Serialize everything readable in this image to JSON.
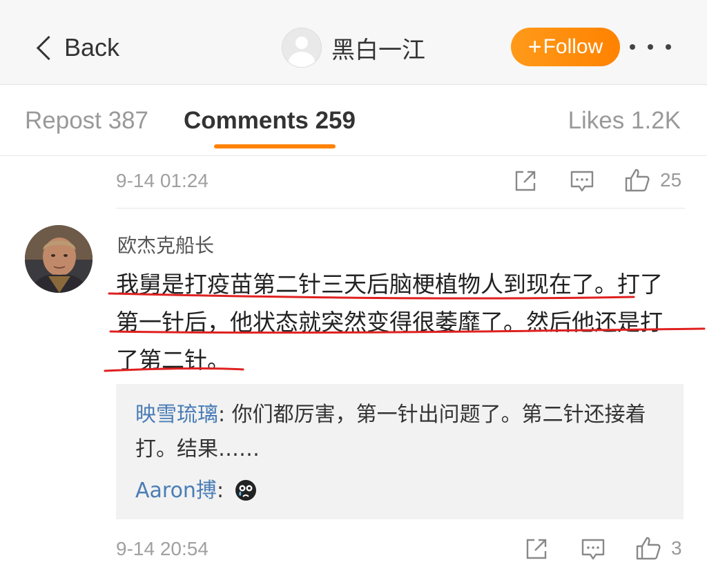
{
  "header": {
    "back_label": "Back",
    "profile_name": "黑白一江",
    "follow_label": "Follow",
    "follow_prefix": "+"
  },
  "tabs": {
    "repost": "Repost 387",
    "comments": "Comments 259",
    "likes": "Likes 1.2K"
  },
  "colors": {
    "accent": "#ff8200",
    "link": "#4a7db5",
    "annotation": "#e02020"
  },
  "comments": [
    {
      "time": "9-14 01:24",
      "likes": "25"
    },
    {
      "username": "欧杰克船长",
      "lines": [
        "我舅是打疫苗第二针三天后脑梗植物人到现在了。打了",
        "第一针后，他状态就突然变得很萎靡了。然后他还是打",
        "了第二针。"
      ],
      "replies": [
        {
          "user": "映雪琉璃",
          "sep": ": ",
          "text": "你们都厉害，第一针出问题了。第二针还接着打。结果……"
        },
        {
          "user": "Aaron搏",
          "sep": ": ",
          "emoji": "crying-face-icon"
        }
      ],
      "time": "9-14 20:54",
      "likes": "3"
    }
  ]
}
